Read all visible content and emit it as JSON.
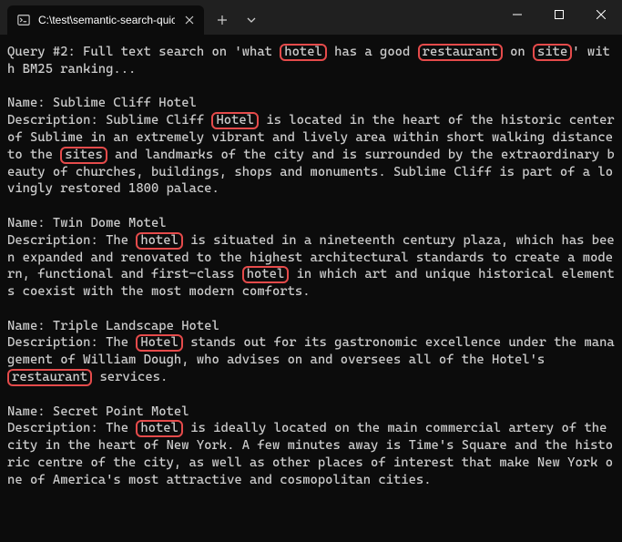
{
  "window": {
    "tab_title": "C:\\test\\semantic-search-quick"
  },
  "query": {
    "prefix": "Query #2: Full text search on 'what ",
    "t1": "hotel",
    "mid1": " has a good ",
    "t2": "restaurant",
    "mid2": " on ",
    "t3": "site",
    "suffix": "' with BM25 ranking..."
  },
  "r1": {
    "name_line": "Name: Sublime Cliff Hotel",
    "d_pre": "Description: Sublime Cliff ",
    "d_t1": "Hotel",
    "d_mid1": " is located in the heart of the historic center of Sublime in an extremely vibrant and lively area within short walking distance to the ",
    "d_t2": "sites",
    "d_post": " and landmarks of the city and is surrounded by the extraordinary beauty of churches, buildings, shops and monuments. Sublime Cliff is part of a lovingly restored 1800 palace."
  },
  "r2": {
    "name_line": "Name: Twin Dome Motel",
    "d_pre": "Description: The ",
    "d_t1": "hotel",
    "d_mid1": " is situated in a  nineteenth century plaza, which has been expanded and renovated to the highest architectural standards to create a modern, functional and first-class ",
    "d_t2": "hotel",
    "d_post": " in which art and unique historical elements coexist with the most modern comforts."
  },
  "r3": {
    "name_line": "Name: Triple Landscape Hotel",
    "d_pre": "Description: The ",
    "d_t1": "Hotel",
    "d_mid1": " stands out for its gastronomic excellence under the management of William Dough, who advises on and oversees all of the Hotel's ",
    "d_t2": "restaurant",
    "d_post": " services."
  },
  "r4": {
    "name_line": "Name: Secret Point Motel",
    "d_pre": "Description: The ",
    "d_t1": "hotel",
    "d_post": " is ideally located on the main commercial artery of the city in the heart of New York. A few minutes away is Time's Square and the historic centre of the city, as well as other places of interest that make New York one of America's most attractive and cosmopolitan cities."
  }
}
